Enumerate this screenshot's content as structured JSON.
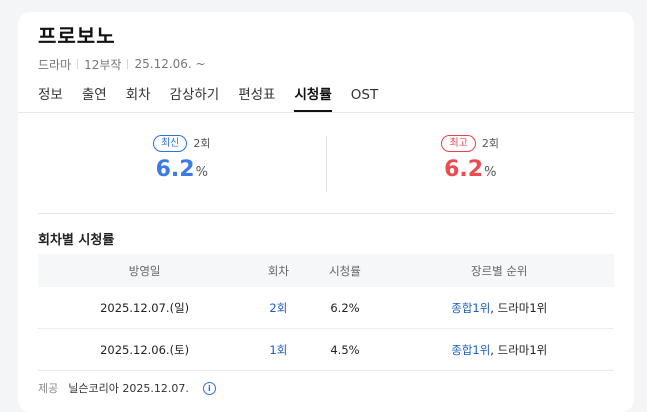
{
  "header": {
    "title": "프로보노",
    "meta": [
      "드라마",
      "12부작",
      "25.12.06. ~"
    ]
  },
  "tabs": [
    "정보",
    "출연",
    "회차",
    "감상하기",
    "편성표",
    "시청률",
    "OST"
  ],
  "active_tab": "시청률",
  "ratings": {
    "latest": {
      "badge": "최신",
      "episode": "2회",
      "value": "6.2",
      "unit": "%"
    },
    "highest": {
      "badge": "최고",
      "episode": "2회",
      "value": "6.2",
      "unit": "%"
    }
  },
  "section_title": "회차별 시청률",
  "table": {
    "headers": [
      "방영일",
      "회차",
      "시청률",
      "장르별 순위"
    ],
    "rows": [
      {
        "date": "2025.12.07.(일)",
        "episode": "2회",
        "rating": "6.2%",
        "rank_link": "종합1위",
        "rank_rest": ", 드라마1위"
      },
      {
        "date": "2025.12.06.(토)",
        "episode": "1회",
        "rating": "4.5%",
        "rank_link": "종합1위",
        "rank_rest": ", 드라마1위"
      }
    ]
  },
  "footer": {
    "label": "제공",
    "provider": "닐슨코리아 2025.12.07."
  },
  "colors": {
    "accent_blue": "#3b7ae8",
    "accent_red": "#ec4c51",
    "link": "#1a5ec2"
  }
}
